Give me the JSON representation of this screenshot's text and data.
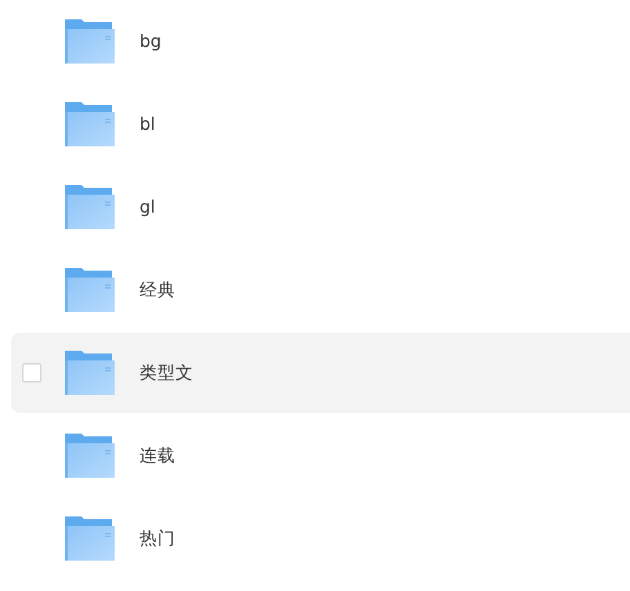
{
  "folders": [
    {
      "name": "bg",
      "hovered": false
    },
    {
      "name": "bl",
      "hovered": false
    },
    {
      "name": "gl",
      "hovered": false
    },
    {
      "name": "经典",
      "hovered": false
    },
    {
      "name": "类型文",
      "hovered": true,
      "checked": false
    },
    {
      "name": "连载",
      "hovered": false
    },
    {
      "name": "热门",
      "hovered": false
    }
  ]
}
